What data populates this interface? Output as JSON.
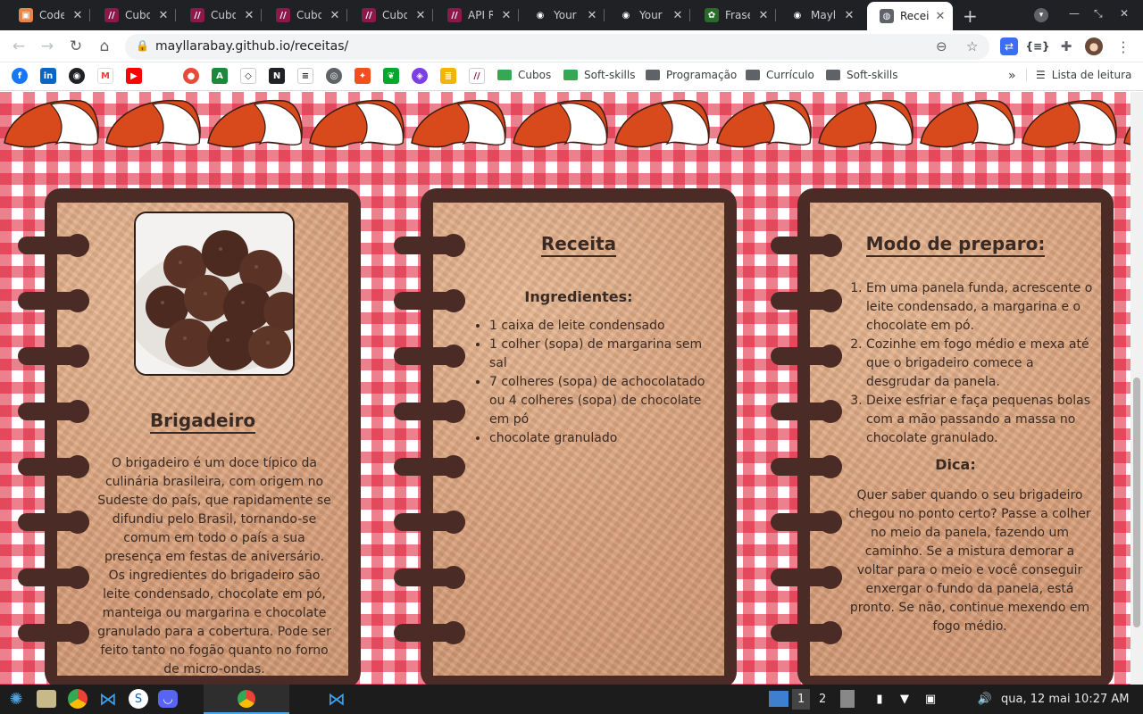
{
  "browser": {
    "tabs": [
      {
        "title": "CodeL",
        "fav_color": "#e8844a",
        "fav": "▣"
      },
      {
        "title": "Cubos",
        "fav_color": "#8b1a4a",
        "fav": "//"
      },
      {
        "title": "Cubos",
        "fav_color": "#8b1a4a",
        "fav": "//"
      },
      {
        "title": "Cubos",
        "fav_color": "#8b1a4a",
        "fav": "//"
      },
      {
        "title": "Cubos",
        "fav_color": "#8b1a4a",
        "fav": "//"
      },
      {
        "title": "API RE",
        "fav_color": "#8b1a4a",
        "fav": "//"
      },
      {
        "title": "Your I",
        "fav_color": "#202124",
        "fav": "◉"
      },
      {
        "title": "Your I",
        "fav_color": "#202124",
        "fav": "◉"
      },
      {
        "title": "Frase",
        "fav_color": "#2a6b2a",
        "fav": "✿"
      },
      {
        "title": "Maylla",
        "fav_color": "#202124",
        "fav": "◉"
      },
      {
        "title": "Recei",
        "fav_color": "#5f6368",
        "fav": "◍"
      }
    ],
    "url": "mayllarabay.github.io/receitas/"
  },
  "bookmarks": {
    "folders": [
      {
        "label": "Cubos",
        "color": "#34a853"
      },
      {
        "label": "Soft-skills",
        "color": "#34a853"
      },
      {
        "label": "Programação",
        "color": "#5f6368"
      },
      {
        "label": "Currículo",
        "color": "#5f6368"
      },
      {
        "label": "Soft-skills",
        "color": "#5f6368"
      }
    ],
    "reading_list": "Lista de leitura"
  },
  "recipe": {
    "title": "Brigadeiro",
    "description": "O brigadeiro é um doce típico da culinária brasileira, com origem no Sudeste do país, que rapidamente se difundiu pelo Brasil, tornando-se comum em todo o país a sua presença em festas de aniversário. Os ingredientes do brigadeiro são leite condensado, chocolate em pó, manteiga ou margarina e chocolate granulado para a cobertura. Pode ser feito tanto no fogão quanto no forno de micro-ondas.",
    "receita_heading": "Receita",
    "ingredients_heading": "Ingredientes:",
    "ingredients": [
      "1 caixa de leite condensado",
      "1 colher (sopa) de margarina sem sal",
      "7 colheres (sopa) de achocolatado ou 4 colheres (sopa) de chocolate em pó",
      "chocolate granulado"
    ],
    "method_heading": "Modo de preparo:",
    "steps": [
      "Em uma panela funda, acrescente o leite condensado, a margarina e o chocolate em pó.",
      "Cozinhe em fogo médio e mexa até que o brigadeiro comece a desgrudar da panela.",
      "Deixe esfriar e faça pequenas bolas com a mão passando a massa no chocolate granulado."
    ],
    "tip_heading": "Dica:",
    "tip": "Quer saber quando o seu brigadeiro chegou no ponto certo? Passe a colher no meio da panela, fazendo um caminho. Se a mistura demorar a voltar para o meio e você conseguir enxergar o fundo da panela, está pronto. Se não, continue mexendo em fogo médio."
  },
  "taskbar": {
    "workspace_1": "1",
    "workspace_2": "2",
    "clock": "qua, 12 mai 10:27 AM"
  }
}
